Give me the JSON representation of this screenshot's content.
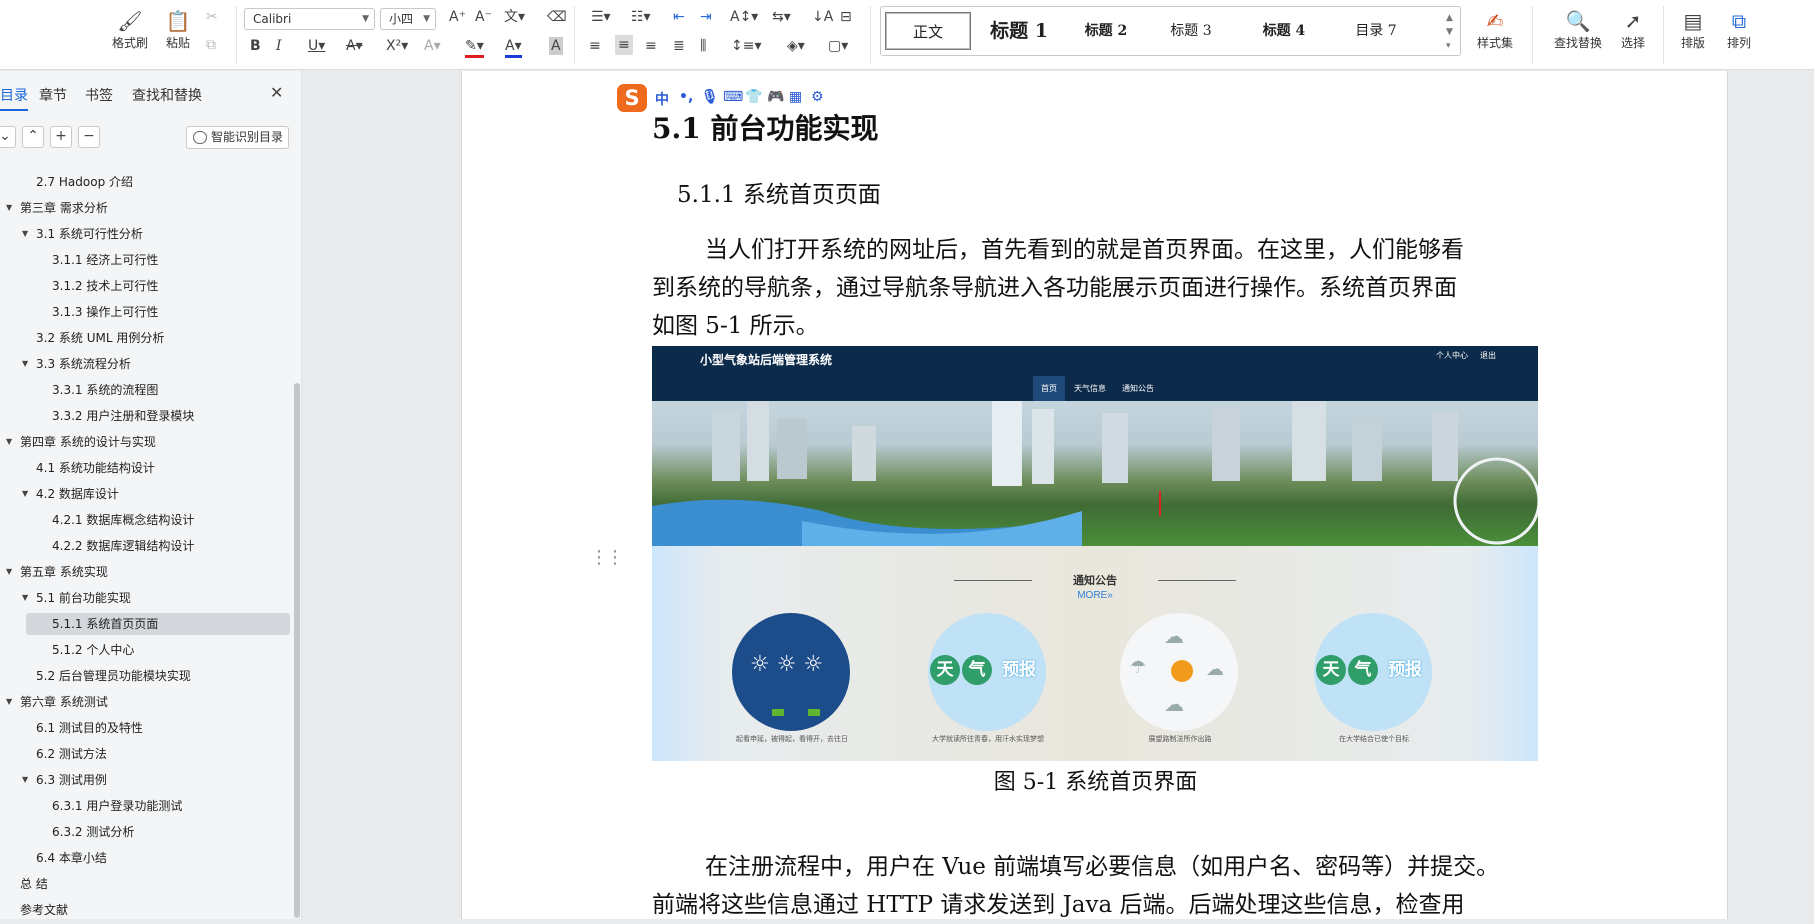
{
  "ribbon": {
    "format_painter": "格式刷",
    "paste": "粘贴",
    "font_name": "Calibri",
    "font_size": "小四",
    "styles": [
      "正文",
      "标题 1",
      "标题 2",
      "标题 3",
      "标题 4",
      "目录 7"
    ],
    "style_set": "样式集",
    "find_replace": "查找替换",
    "select": "选择",
    "layout": "排版",
    "arrange": "排列"
  },
  "nav": {
    "tabs": [
      "目录",
      "章节",
      "书签",
      "查找和替换"
    ],
    "smart_toc": "智能识别目录",
    "items": [
      {
        "label": "2.7 Hadoop 介绍",
        "level": 1,
        "arrow": false
      },
      {
        "label": "第三章  需求分析",
        "level": 0,
        "arrow": true
      },
      {
        "label": "3.1  系统可行性分析",
        "level": 1,
        "arrow": true
      },
      {
        "label": "3.1.1 经济上可行性",
        "level": 2,
        "arrow": false
      },
      {
        "label": "3.1.2 技术上可行性",
        "level": 2,
        "arrow": false
      },
      {
        "label": "3.1.3 操作上可行性",
        "level": 2,
        "arrow": false
      },
      {
        "label": "3.2 系统 UML 用例分析",
        "level": 1,
        "arrow": false
      },
      {
        "label": "3.3 系统流程分析",
        "level": 1,
        "arrow": true
      },
      {
        "label": "3.3.1 系统的流程图",
        "level": 2,
        "arrow": false
      },
      {
        "label": "3.3.2 用户注册和登录模块",
        "level": 2,
        "arrow": false
      },
      {
        "label": "第四章  系统的设计与实现",
        "level": 0,
        "arrow": true
      },
      {
        "label": "4.1  系统功能结构设计",
        "level": 1,
        "arrow": false
      },
      {
        "label": "4.2  数据库设计",
        "level": 1,
        "arrow": true
      },
      {
        "label": "4.2.1 数据库概念结构设计",
        "level": 2,
        "arrow": false
      },
      {
        "label": "4.2.2 数据库逻辑结构设计",
        "level": 2,
        "arrow": false
      },
      {
        "label": "第五章  系统实现",
        "level": 0,
        "arrow": true
      },
      {
        "label": "5.1 前台功能实现",
        "level": 1,
        "arrow": true
      },
      {
        "label": "5.1.1 系统首页页面",
        "level": 2,
        "arrow": false,
        "selected": true
      },
      {
        "label": "5.1.2 个人中心",
        "level": 2,
        "arrow": false
      },
      {
        "label": "5.2 后台管理员功能模块实现",
        "level": 1,
        "arrow": false
      },
      {
        "label": "第六章  系统测试",
        "level": 0,
        "arrow": true
      },
      {
        "label": "6.1 测试目的及特性",
        "level": 1,
        "arrow": false
      },
      {
        "label": "6.2 测试方法",
        "level": 1,
        "arrow": false
      },
      {
        "label": "6.3 测试用例",
        "level": 1,
        "arrow": true
      },
      {
        "label": "6.3.1 用户登录功能测试",
        "level": 2,
        "arrow": false
      },
      {
        "label": "6.3.2 测试分析",
        "level": 2,
        "arrow": false
      },
      {
        "label": "6.4 本章小结",
        "level": 1,
        "arrow": false
      },
      {
        "label": "总  结",
        "level": 0,
        "arrow": false
      },
      {
        "label": "参考文献",
        "level": 0,
        "arrow": false
      }
    ]
  },
  "ime": {
    "zh": "中"
  },
  "doc": {
    "heading1": "5.1 前台功能实现",
    "heading2": "5.1.1 系统首页页面",
    "para1": [
      "当人们打开系统的网址后，首先看到的就是首页界面。在这里，人们能够看",
      "到系统的导航条，通过导航条导航进入各功能展示页面进行操作。系统首页界面",
      "如图 5-1 所示。"
    ],
    "caption": "图 5-1 系统首页界面",
    "para2": [
      "在注册流程中，用户在 Vue 前端填写必要信息（如用户名、密码等）并提交。",
      "前端将这些信息通过 HTTP 请求发送到 Java 后端。后端处理这些信息，检查用"
    ]
  },
  "figure": {
    "site_title": "小型气象站后端管理系统",
    "user_center": "个人中心",
    "logout": "退出",
    "nav": [
      "首页",
      "天气信息",
      "通知公告"
    ],
    "notice_title": "通知公告",
    "more": "MORE»",
    "forecast_word": [
      "天",
      "气",
      "预报"
    ],
    "captions": [
      "起看申延，被得起，看得开，去往日",
      "大学就读所往青春，用汗水实现梦想",
      "展望路制法所作出路",
      "在大学结合已使个目标"
    ]
  }
}
